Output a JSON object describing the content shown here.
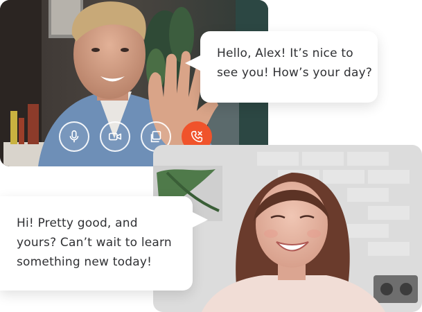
{
  "call": {
    "remote_message": {
      "lines": [
        "Hello, Alex! It’s nice to",
        "see you! How’s your day?"
      ]
    },
    "local_message": {
      "lines": [
        "Hi! Pretty good, and",
        "yours? Can’t wait to learn",
        "something new today!"
      ]
    },
    "controls": [
      {
        "name": "microphone",
        "icon": "microphone-icon"
      },
      {
        "name": "camera",
        "icon": "video-camera-icon"
      },
      {
        "name": "share-screen",
        "icon": "copy-windows-icon"
      },
      {
        "name": "end-call",
        "icon": "phone-hangup-icon",
        "color": "#f0532b"
      }
    ]
  },
  "colors": {
    "bubble_text": "#2f3033",
    "end_call": "#f0532b",
    "bubble_bg": "#ffffff"
  }
}
